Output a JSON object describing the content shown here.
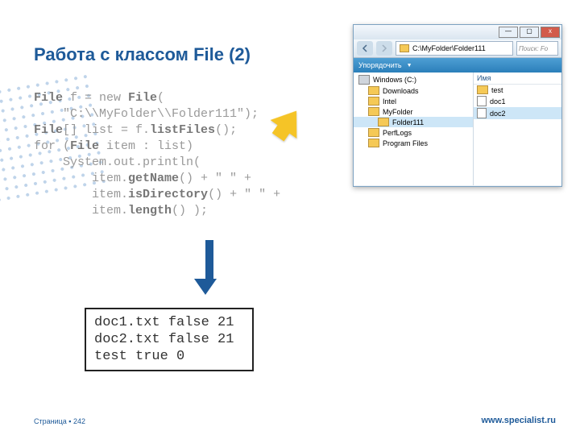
{
  "title": "Работа с классом File (2)",
  "code": {
    "lines": [
      {
        "pre": "",
        "bold": "File",
        "post": " f = new ",
        "bold2": "File",
        "post2": "("
      },
      {
        "pre": "    \"C:\\\\MyFolder\\\\Folder111\");",
        "bold": "",
        "post": ""
      },
      {
        "pre": "",
        "bold": "File",
        "post": "[] list = f.",
        "bold2": "listFiles",
        "post2": "();"
      },
      {
        "pre": "for (",
        "bold": "File",
        "post": " item : list)"
      },
      {
        "pre": "    System.out.println(",
        "bold": "",
        "post": ""
      },
      {
        "pre": "        item.",
        "bold": "getName",
        "post": "() + \" \" +"
      },
      {
        "pre": "        item.",
        "bold": "isDirectory",
        "post": "() + \" \" +"
      },
      {
        "pre": "        item.",
        "bold": "length",
        "post": "() );"
      }
    ]
  },
  "explorer": {
    "address": "C:\\MyFolder\\Folder111",
    "search_placeholder": "Поиск: Fo",
    "toolbar_label": "Упорядочить",
    "tree": [
      {
        "label": "Windows (C:)",
        "indent": 0,
        "type": "drive"
      },
      {
        "label": "Downloads",
        "indent": 1,
        "type": "folder"
      },
      {
        "label": "Intel",
        "indent": 1,
        "type": "folder"
      },
      {
        "label": "MyFolder",
        "indent": 1,
        "type": "folder"
      },
      {
        "label": "Folder111",
        "indent": 2,
        "type": "folder",
        "selected": true
      },
      {
        "label": "PerfLogs",
        "indent": 1,
        "type": "folder"
      },
      {
        "label": "Program Files",
        "indent": 1,
        "type": "folder"
      }
    ],
    "file_header": "Имя",
    "files": [
      {
        "label": "test",
        "type": "folder"
      },
      {
        "label": "doc1",
        "type": "file"
      },
      {
        "label": "doc2",
        "type": "file",
        "selected": true
      }
    ]
  },
  "output": "doc1.txt false 21\ndoc2.txt false 21\ntest true 0",
  "footer": {
    "page": "Страница ▪ 242",
    "site": "www.specialist.ru"
  }
}
